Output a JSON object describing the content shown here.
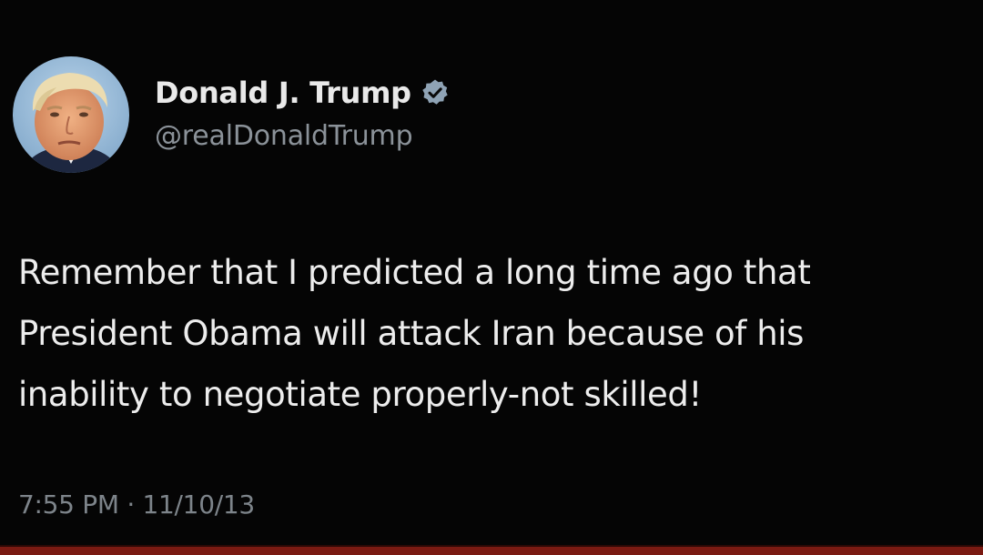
{
  "author": {
    "display_name": "Donald J. Trump",
    "handle": "@realDonaldTrump",
    "verified_icon": "verified-badge-icon",
    "avatar": "profile-photo"
  },
  "tweet": {
    "lines": [
      "Remember that I predicted a long time ago that",
      "President Obama will attack Iran because of his",
      "inability to negotiate properly-not skilled!"
    ],
    "timestamp": "7:55 PM · 11/10/13"
  },
  "colors": {
    "background": "#050505",
    "name_text": "#e9e9e9",
    "handle_text": "#8b9299",
    "body_text": "#ededed",
    "verified_badge": "#8fa3b5",
    "bottom_bar": "#7a1a12"
  }
}
